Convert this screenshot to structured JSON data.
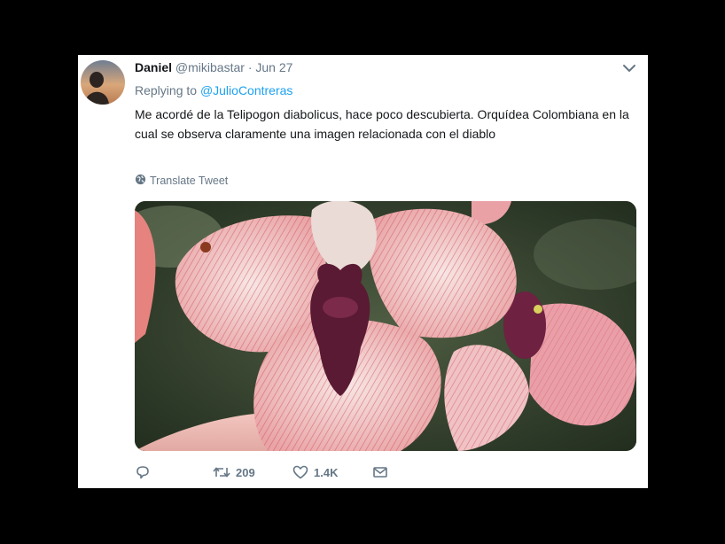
{
  "tweet": {
    "author_name": "Daniel",
    "author_handle": "@mikibastar",
    "separator": "·",
    "date": "Jun 27",
    "replying_prefix": "Replying to",
    "replying_handle": "@JulioContreras",
    "text": "Me acordé de la Telipogon diabolicus, hace poco descubierta. Orquídea Colombiana en la cual se observa claramente una imagen relacionada con el diablo",
    "translate_label": "Translate Tweet",
    "retweet_count": "209",
    "like_count": "1.4K"
  },
  "icons": {
    "menu": "chevron-down-icon",
    "translate": "globe-icon",
    "reply": "reply-icon",
    "retweet": "retweet-icon",
    "like": "heart-icon",
    "dm": "envelope-icon"
  },
  "colors": {
    "background": "#000000",
    "card": "#ffffff",
    "text": "#14171a",
    "muted": "#657786",
    "link": "#1da1f2"
  }
}
